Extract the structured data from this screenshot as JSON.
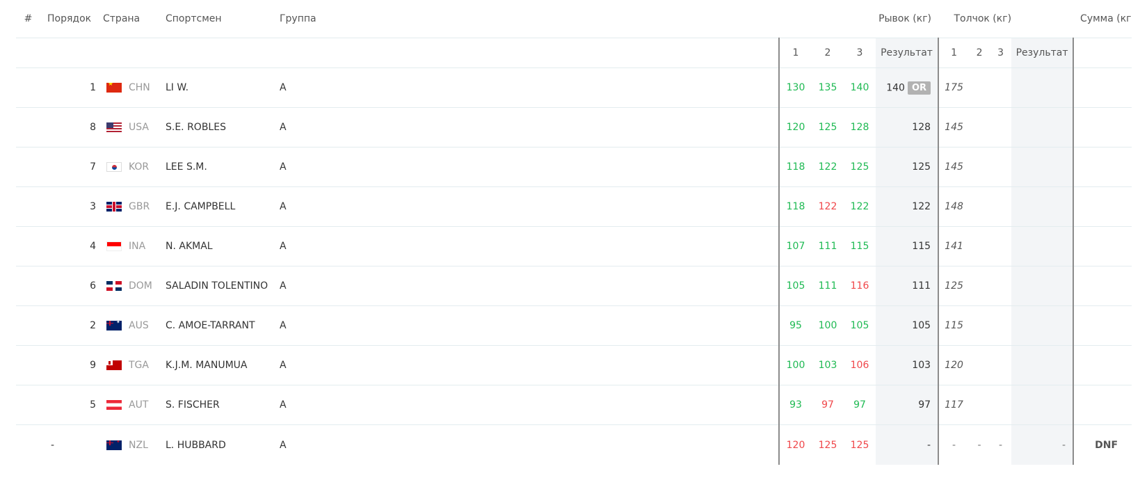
{
  "header": {
    "num": "#",
    "order": "Порядок",
    "country": "Страна",
    "athlete": "Спортсмен",
    "group": "Группа",
    "snatch": "Рывок (кг)",
    "clean_jerk": "Толчок (кг)",
    "total": "Сумма (кг)",
    "attempt1": "1",
    "attempt2": "2",
    "attempt3": "3",
    "result": "Результат"
  },
  "colors": {
    "good_lift": "#1fba53",
    "no_lift": "#f0474a",
    "record_badge": "#b2b2b2"
  },
  "rows": [
    {
      "order": "1",
      "flag_icon": "flag-chn-icon",
      "country": "CHN",
      "athlete": "LI W.",
      "group": "A",
      "s1": "130",
      "s1c": "good",
      "s2": "135",
      "s2c": "good",
      "s3": "140",
      "s3c": "good",
      "snatch_result": "140",
      "record": "OR",
      "cj1": "175",
      "cj2": "",
      "cj3": "",
      "cj_result": "",
      "total": ""
    },
    {
      "order": "8",
      "flag_icon": "flag-usa-icon",
      "country": "USA",
      "athlete": "S.E. ROBLES",
      "group": "A",
      "s1": "120",
      "s1c": "good",
      "s2": "125",
      "s2c": "good",
      "s3": "128",
      "s3c": "good",
      "snatch_result": "128",
      "record": "",
      "cj1": "145",
      "cj2": "",
      "cj3": "",
      "cj_result": "",
      "total": ""
    },
    {
      "order": "7",
      "flag_icon": "flag-kor-icon",
      "country": "KOR",
      "athlete": "LEE S.M.",
      "group": "A",
      "s1": "118",
      "s1c": "good",
      "s2": "122",
      "s2c": "good",
      "s3": "125",
      "s3c": "good",
      "snatch_result": "125",
      "record": "",
      "cj1": "145",
      "cj2": "",
      "cj3": "",
      "cj_result": "",
      "total": ""
    },
    {
      "order": "3",
      "flag_icon": "flag-gbr-icon",
      "country": "GBR",
      "athlete": "E.J. CAMPBELL",
      "group": "A",
      "s1": "118",
      "s1c": "good",
      "s2": "122",
      "s2c": "bad",
      "s3": "122",
      "s3c": "good",
      "snatch_result": "122",
      "record": "",
      "cj1": "148",
      "cj2": "",
      "cj3": "",
      "cj_result": "",
      "total": ""
    },
    {
      "order": "4",
      "flag_icon": "flag-ina-icon",
      "country": "INA",
      "athlete": "N. AKMAL",
      "group": "A",
      "s1": "107",
      "s1c": "good",
      "s2": "111",
      "s2c": "good",
      "s3": "115",
      "s3c": "good",
      "snatch_result": "115",
      "record": "",
      "cj1": "141",
      "cj2": "",
      "cj3": "",
      "cj_result": "",
      "total": ""
    },
    {
      "order": "6",
      "flag_icon": "flag-dom-icon",
      "country": "DOM",
      "athlete": "SALADIN TOLENTINO",
      "group": "A",
      "s1": "105",
      "s1c": "good",
      "s2": "111",
      "s2c": "good",
      "s3": "116",
      "s3c": "bad",
      "snatch_result": "111",
      "record": "",
      "cj1": "125",
      "cj2": "",
      "cj3": "",
      "cj_result": "",
      "total": ""
    },
    {
      "order": "2",
      "flag_icon": "flag-aus-icon",
      "country": "AUS",
      "athlete": "C. AMOE-TARRANT",
      "group": "A",
      "s1": "95",
      "s1c": "good",
      "s2": "100",
      "s2c": "good",
      "s3": "105",
      "s3c": "good",
      "snatch_result": "105",
      "record": "",
      "cj1": "115",
      "cj2": "",
      "cj3": "",
      "cj_result": "",
      "total": ""
    },
    {
      "order": "9",
      "flag_icon": "flag-tga-icon",
      "country": "TGA",
      "athlete": "K.J.M. MANUMUA",
      "group": "A",
      "s1": "100",
      "s1c": "good",
      "s2": "103",
      "s2c": "good",
      "s3": "106",
      "s3c": "bad",
      "snatch_result": "103",
      "record": "",
      "cj1": "120",
      "cj2": "",
      "cj3": "",
      "cj_result": "",
      "total": ""
    },
    {
      "order": "5",
      "flag_icon": "flag-aut-icon",
      "country": "AUT",
      "athlete": "S. FISCHER",
      "group": "A",
      "s1": "93",
      "s1c": "good",
      "s2": "97",
      "s2c": "bad",
      "s3": "97",
      "s3c": "good",
      "snatch_result": "97",
      "record": "",
      "cj1": "117",
      "cj2": "",
      "cj3": "",
      "cj_result": "",
      "total": ""
    },
    {
      "order": "-",
      "flag_icon": "flag-nzl-icon",
      "country": "NZL",
      "athlete": "L. HUBBARD",
      "group": "A",
      "s1": "120",
      "s1c": "bad",
      "s2": "125",
      "s2c": "bad",
      "s3": "125",
      "s3c": "bad",
      "snatch_result": "-",
      "record": "",
      "cj1": "-",
      "cj2": "-",
      "cj3": "-",
      "cj_result": "-",
      "total": "DNF"
    }
  ]
}
